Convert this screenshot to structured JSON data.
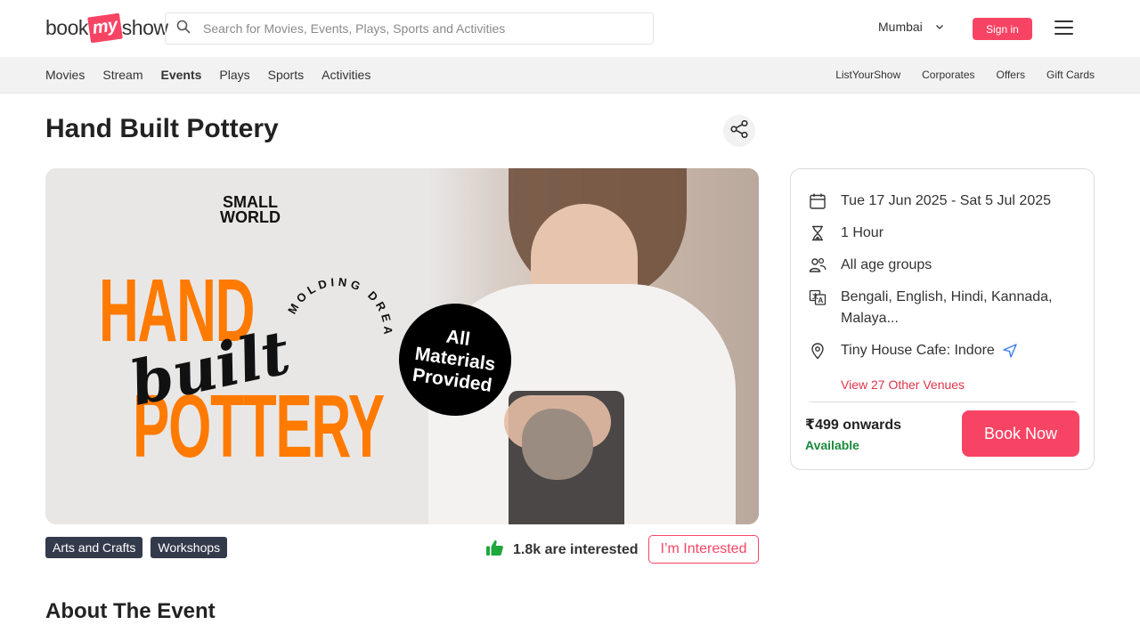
{
  "header": {
    "logo_parts": [
      "book",
      "my",
      "show"
    ],
    "search_placeholder": "Search for Movies, Events, Plays, Sports and Activities",
    "city": "Mumbai",
    "signin_label": "Sign in"
  },
  "subnav": {
    "left": [
      "Movies",
      "Stream",
      "Events",
      "Plays",
      "Sports",
      "Activities"
    ],
    "active": "Events",
    "right": [
      "ListYourShow",
      "Corporates",
      "Offers",
      "Gift Cards"
    ]
  },
  "event": {
    "title": "Hand Built Pottery",
    "banner": {
      "brand_line1": "SMALL",
      "brand_line2": "WORLD",
      "word_hand": "HAND",
      "word_built": "built",
      "word_pottery": "POTTERY",
      "arc_text": "MOLDING DREAMS",
      "badge_line1": "All",
      "badge_line2": "Materials",
      "badge_line3": "Provided"
    },
    "tags": [
      "Arts and Crafts",
      "Workshops"
    ],
    "interested_count": "1.8k are interested",
    "interested_button": "I’m Interested"
  },
  "card": {
    "dates": "Tue 17 Jun 2025 - Sat 5 Jul 2025",
    "duration": "1 Hour",
    "age": "All age groups",
    "languages_line1": "Bengali, English, Hindi, Kannada,",
    "languages_line2": "Malaya...",
    "venue": "Tiny House Cafe: Indore",
    "other_venues": "View 27 Other Venues",
    "price": "₹499 onwards",
    "availability": "Available",
    "book_label": "Book Now"
  },
  "about_title": "About The Event",
  "colors": {
    "brand": "#f84464",
    "tag_bg": "#333a4b",
    "available": "#1a8a3c",
    "banner_orange": "#ff7a00"
  },
  "icons": [
    "search-icon",
    "chevron-down-icon",
    "menu-icon",
    "share-icon",
    "calendar-icon",
    "hourglass-icon",
    "people-icon",
    "language-icon",
    "location-icon",
    "navigation-icon",
    "thumbs-up-icon"
  ]
}
